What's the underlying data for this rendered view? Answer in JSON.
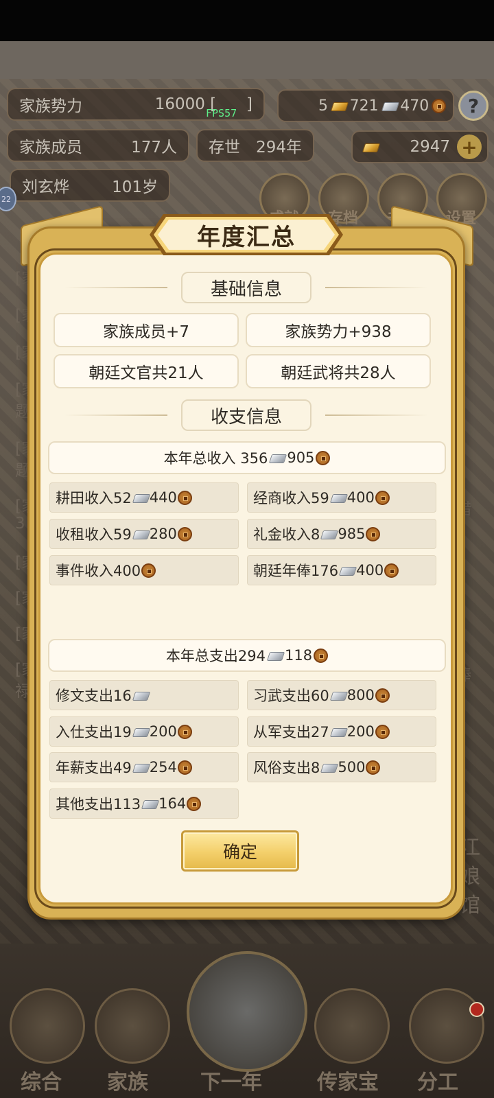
{
  "background": {
    "top_stats": {
      "clan_power_label": "家族势力",
      "clan_power_value": "16000 [",
      "clan_power_tail": "]",
      "fps": "FPS57",
      "resources": {
        "gold_ingot": "5",
        "silver": "721",
        "coins": "470"
      },
      "members_label": "家族成员",
      "members_value": "177人",
      "alive_label": "存世",
      "alive_value": "294年",
      "gold": "2947",
      "head_name": "刘玄烨",
      "head_age": "101岁",
      "help": "?",
      "side_badge": "22"
    },
    "menu_icons": [
      "成就",
      "存档",
      "书信",
      "设置"
    ],
    "log_fragments": [
      "[家",
      "[家",
      "[家",
      "[家",
      "题",
      "[家",
      "题",
      "[家",
      "3",
      "[家",
      "[家",
      "[家",
      "[家",
      "禄"
    ],
    "right_fragments": [
      "措",
      "俸",
      "江",
      "娘",
      "馆"
    ],
    "bottom_nav": [
      "综合",
      "家族",
      "下一年",
      "传家宝",
      "分工"
    ]
  },
  "modal": {
    "title": "年度汇总",
    "basic_section": {
      "title": "基础信息",
      "items": [
        "家族成员+7",
        "家族势力+938",
        "朝廷文官共21人",
        "朝廷武将共28人"
      ]
    },
    "finance_section": {
      "title": "收支信息",
      "income_total": {
        "label": "本年总收入 356",
        "silver": "",
        "coins": "905"
      },
      "income_items": [
        {
          "label": "耕田收入52",
          "coins": "440",
          "has_silver": true
        },
        {
          "label": "经商收入59",
          "coins": "400",
          "has_silver": true
        },
        {
          "label": "收租收入59",
          "coins": "280",
          "has_silver": true
        },
        {
          "label": "礼金收入8",
          "coins": "985",
          "has_silver": true
        },
        {
          "label": "事件收入400",
          "coins": "",
          "has_silver": false
        },
        {
          "label": "朝廷年俸176",
          "coins": "400",
          "has_silver": true
        }
      ],
      "expense_total": {
        "label": "本年总支出294",
        "coins": "118"
      },
      "expense_items": [
        {
          "label": "修文支出16",
          "coins": "",
          "has_coin": false
        },
        {
          "label": "习武支出60",
          "coins": "800",
          "has_coin": true
        },
        {
          "label": "入仕支出19",
          "coins": "200",
          "has_coin": true
        },
        {
          "label": "从军支出27",
          "coins": "200",
          "has_coin": true
        },
        {
          "label": "年薪支出49",
          "coins": "254",
          "has_coin": true
        },
        {
          "label": "风俗支出8",
          "coins": "500",
          "has_coin": true
        },
        {
          "label": "其他支出113",
          "coins": "164",
          "has_coin": true
        }
      ]
    },
    "confirm_label": "确定"
  }
}
